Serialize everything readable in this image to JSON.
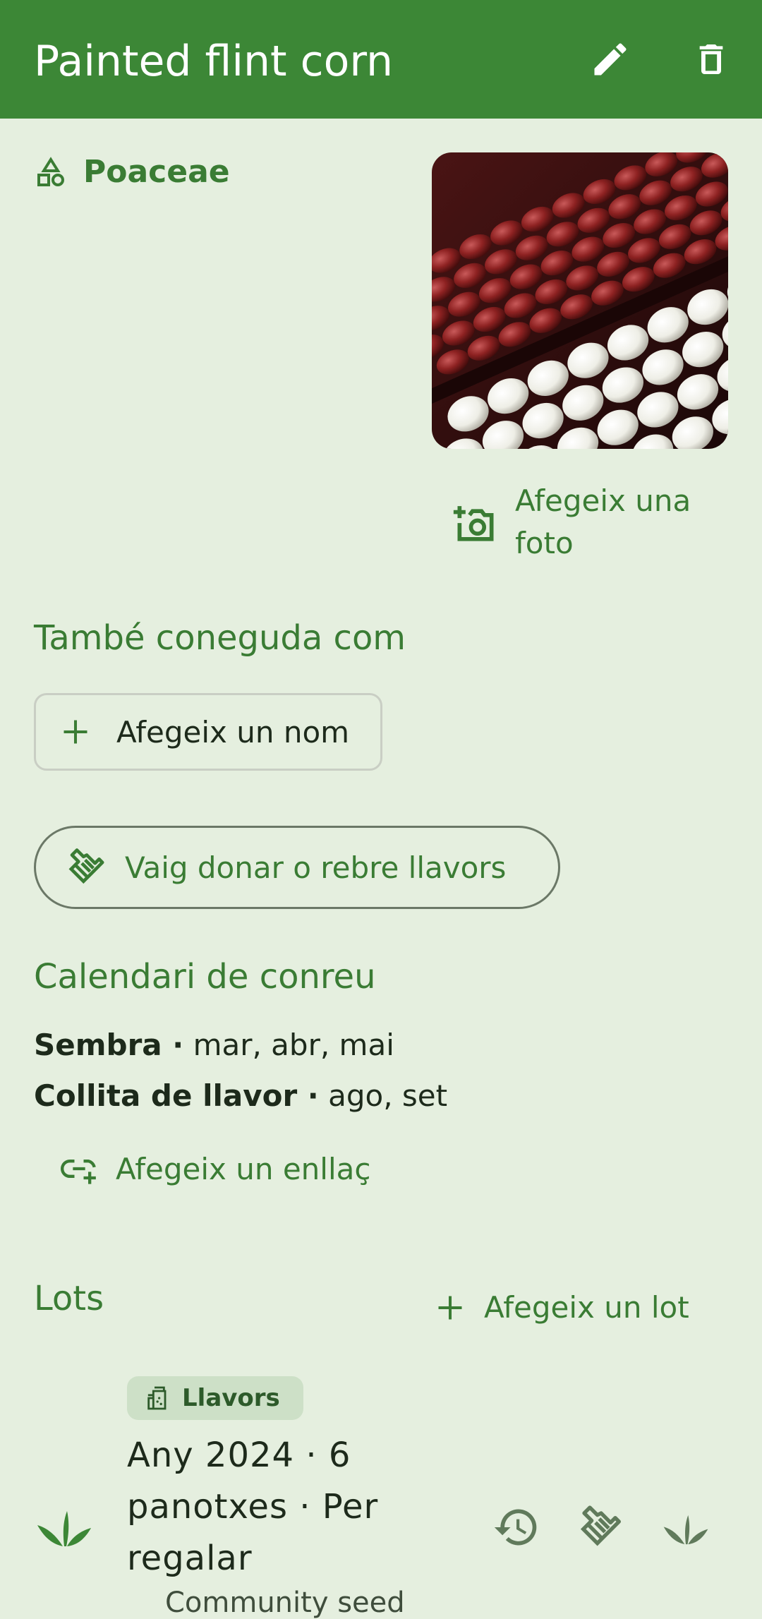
{
  "appbar": {
    "title": "Painted flint corn",
    "edit_icon": "pencil-icon",
    "delete_icon": "trash-icon"
  },
  "family": {
    "label": "Poaceae",
    "icon": "shapes-icon"
  },
  "photo": {
    "description_icon": "corn-photo"
  },
  "add_photo": {
    "label": "Afegeix una foto",
    "icon": "camera-plus-icon"
  },
  "aliases": {
    "title": "També coneguda com",
    "add_name_label": "Afegeix un nom"
  },
  "donate": {
    "label": "Vaig donar o rebre llavors",
    "icon": "handshake-icon"
  },
  "calendar": {
    "title": "Calendari de conreu",
    "rows": [
      {
        "label": "Sembra ·",
        "value": "mar, abr, mai"
      },
      {
        "label": "Collita de llavor ·",
        "value": "ago, set"
      }
    ],
    "add_link_label": "Afegeix un enllaç"
  },
  "lots": {
    "title": "Lots",
    "add_lot_label": "Afegeix un lot",
    "items": [
      {
        "chip_label": "Llavors",
        "text": "Any 2024 · 6 panotxes · Per regalar",
        "subtext": "Community seed"
      }
    ]
  },
  "colors": {
    "primary": "#3c8736",
    "background": "#e5efdf",
    "accent_text": "#3a7c34",
    "chip": "#cde0c7"
  }
}
